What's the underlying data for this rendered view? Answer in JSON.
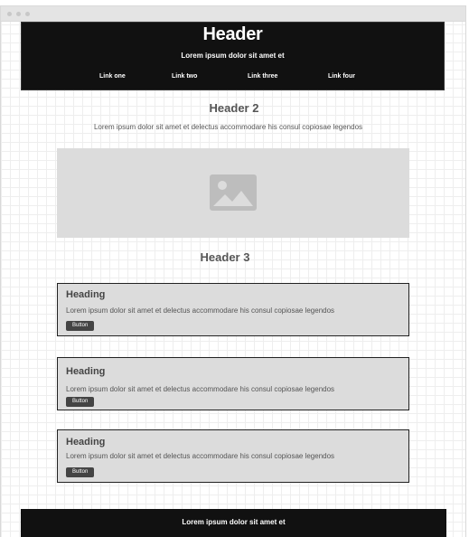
{
  "header": {
    "title": "Header",
    "tagline": "Lorem ipsum dolor sit amet et",
    "nav": [
      "Link one",
      "Link two",
      "Link three",
      "Link four"
    ]
  },
  "section2": {
    "title": "Header 2",
    "text": "Lorem ipsum dolor sit amet et delectus accommodare his consul copiosae legendos",
    "image_icon": "image-placeholder-icon"
  },
  "section3": {
    "title": "Header 3",
    "cards": [
      {
        "title": "Heading",
        "text": "Lorem ipsum dolor sit amet et delectus accommodare his consul copiosae legendos",
        "button": "Button"
      },
      {
        "title": "Heading",
        "text": "Lorem ipsum dolor sit amet et delectus accommodare his consul copiosae legendos",
        "button": "Button"
      },
      {
        "title": "Heading",
        "text": "Lorem ipsum dolor sit amet et delectus accommodare his consul copiosae legendos",
        "button": "Button"
      }
    ]
  },
  "footer": {
    "text": "Lorem ipsum dolor sit amet et"
  },
  "colors": {
    "dark": "#111111",
    "panel": "#dcdcdc",
    "button": "#444444",
    "text": "#555555"
  }
}
